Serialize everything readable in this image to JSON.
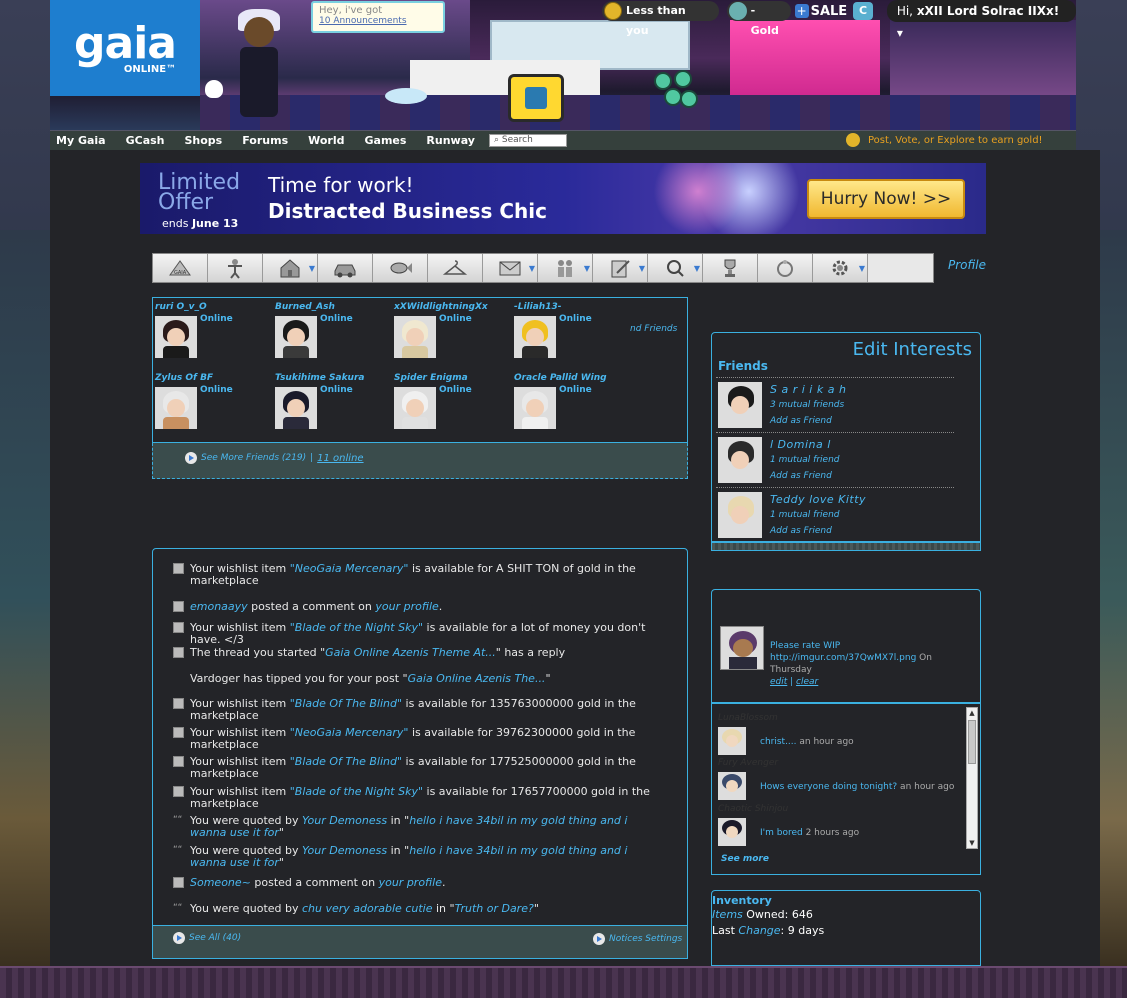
{
  "header": {
    "logo_text": "gaia",
    "logo_sub": "ONLINE™",
    "announcement_line1": "Hey, i've got",
    "announcement_line2": "10 Announcements",
    "ltu_label": "Less than you",
    "gold_label": "-Gold",
    "sale_label": "SALE",
    "cash_icon": "C",
    "greeting_prefix": "Hi,",
    "username": "xXII Lord Solrac IIXx!"
  },
  "nav": {
    "items": [
      "My Gaia",
      "GCash",
      "Shops",
      "Forums",
      "World",
      "Games",
      "Runway"
    ],
    "search_placeholder": "Search",
    "earn_text": "Post, Vote, or Explore to earn gold!"
  },
  "banner": {
    "limited": "Limited",
    "offer": "Offer",
    "ends_prefix": "ends",
    "ends_date": "June 13",
    "title1": "Time for work!",
    "title2": "Distracted Business Chic",
    "cta": "Hurry Now! >>"
  },
  "toolbar": {
    "icons": [
      "gaia-logo-icon",
      "avatar-icon",
      "home-icon",
      "car-icon",
      "fish-icon",
      "hanger-icon",
      "mail-icon",
      "friends-icon",
      "notebook-icon",
      "search-icon",
      "trophy-icon",
      "ring-icon",
      "gear-icon"
    ],
    "profile_label": "Profile"
  },
  "friends": {
    "list": [
      {
        "name": "ruri O_v_O",
        "status": "Online",
        "hair": "#2a1a1a",
        "body": "#1a1a1a"
      },
      {
        "name": "Burned_Ash",
        "status": "Online",
        "hair": "#1a1a1a",
        "body": "#3a3a3a"
      },
      {
        "name": "xXWildlightningXx",
        "status": "Online",
        "hair": "#f0e8d0",
        "body": "#d8c8a0"
      },
      {
        "name": "-Liliah13-",
        "status": "Online",
        "hair": "#f0c020",
        "body": "#2a2a2a"
      },
      {
        "name": "Zylus Of BF",
        "status": "Online",
        "hair": "#e8e8e8",
        "body": "#c89060"
      },
      {
        "name": "Tsukihime Sakura",
        "status": "Online",
        "hair": "#1a1a2a",
        "body": "#2a2a3a"
      },
      {
        "name": "Spider Enigma",
        "status": "Online",
        "hair": "#f0f0f0",
        "body": "#e0e0e0"
      },
      {
        "name": "Oracle Pallid Wing",
        "status": "Online",
        "hair": "#e8e8e8",
        "body": "#f0f0f0"
      }
    ],
    "find_label": "nd Friends",
    "see_more": "See More Friends (219)",
    "separator": "|",
    "online_count": "11 online"
  },
  "notices": {
    "items": [
      {
        "pre": "Your wishlist item ",
        "link": "\"NeoGaia Mercenary\"",
        "post": " is available for A SHIT TON of gold in the marketplace"
      },
      {
        "pre": "",
        "link": "emonaayy",
        "mid": " posted a comment on ",
        "link2": "your profile",
        "post": "."
      },
      {
        "pre": "Your wishlist item ",
        "link": "\"Blade of the Night Sky\"",
        "post": " is available for a lot of money you don't have. </3"
      },
      {
        "pre": "The thread you started \"",
        "link": "Gaia Online Azenis Theme At...",
        "post": "\" has a reply"
      },
      {
        "pre": "Vardoger has tipped you for your post \"",
        "link": "Gaia Online Azenis The...",
        "post": "\""
      },
      {
        "pre": "Your wishlist item ",
        "link": "\"Blade Of The Blind\"",
        "post": " is available for 135763000000 gold in the marketplace"
      },
      {
        "pre": "Your wishlist item ",
        "link": "\"NeoGaia Mercenary\"",
        "post": " is available for 39762300000 gold in the marketplace"
      },
      {
        "pre": "Your wishlist item ",
        "link": "\"Blade Of The Blind\"",
        "post": " is available for 177525000000 gold in the marketplace"
      },
      {
        "pre": "Your wishlist item ",
        "link": "\"Blade of the Night Sky\"",
        "post": " is available for 17657700000 gold in the marketplace"
      },
      {
        "pre": "You were quoted by ",
        "link": "Your Demoness",
        "mid": " in \"",
        "link2": "hello i have 34bil in my gold thing and i wanna use it for",
        "post": "\""
      },
      {
        "pre": "You were quoted by ",
        "link": "Your Demoness",
        "mid": " in \"",
        "link2": "hello i have 34bil in my gold thing and i wanna use it for",
        "post": "\""
      },
      {
        "pre": "",
        "link": "Someone~",
        "mid": " posted a comment on ",
        "link2": "your profile",
        "post": "."
      },
      {
        "pre": "You were quoted by ",
        "link": "chu very adorable cutie",
        "mid": " in \"",
        "link2": "Truth or Dare?",
        "post": "\""
      }
    ],
    "see_all": "See All (40)",
    "settings": "Notices Settings"
  },
  "interests": {
    "edit_label": "Edit Interests",
    "friends_header": "Friends",
    "suggestions": [
      {
        "name": "S a r i i k a h",
        "mutual": "3 mutual friends",
        "add": "Add as Friend",
        "hair": "#1a1a1a"
      },
      {
        "name": "l Domina l",
        "mutual": "1 mutual friend",
        "add": "Add as Friend",
        "hair": "#2a2a2a"
      },
      {
        "name": "Teddy love Kitty",
        "mutual": "1 mutual friend",
        "add": "Add as Friend",
        "hair": "#e8d8b0"
      }
    ]
  },
  "status": {
    "text": "Please rate WIP",
    "url": "http://imgur.com/37QwMX7l.png",
    "when": " On Thursday",
    "edit": "edit",
    "sep": " | ",
    "clear": "clear"
  },
  "feed": {
    "items": [
      {
        "user": "LunaBlossom",
        "text": "christ....",
        "time": " an hour ago",
        "hair": "#e8d8b0"
      },
      {
        "user": "Fury Avenger",
        "text": "Hows everyone doing tonight?",
        "time": " an hour ago",
        "hair": "#3a4a6a"
      },
      {
        "user": "Chaotic Shinjou",
        "text": "I'm bored",
        "time": " 2 hours ago",
        "hair": "#1a1a2a"
      }
    ],
    "see_more": "See more"
  },
  "inventory": {
    "header": "Inventory",
    "items_label": "Items",
    "owned": " Owned: 646",
    "last_prefix": "Last ",
    "change_label": "Change",
    "last_value": ":  9 days"
  }
}
